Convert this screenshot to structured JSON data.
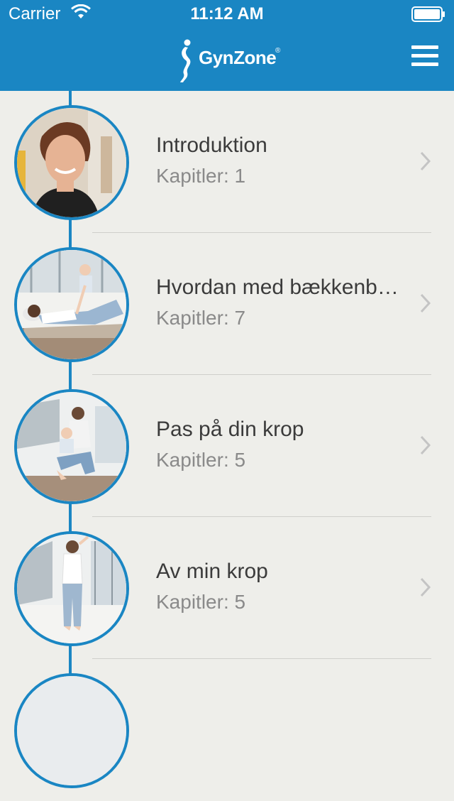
{
  "status_bar": {
    "carrier": "Carrier",
    "time": "11:12 AM"
  },
  "nav": {
    "logo_text": "GynZone",
    "logo_mark": "®",
    "menu_icon": "hamburger-menu-icon"
  },
  "colors": {
    "brand_blue": "#1a86c3",
    "background": "#eeeeea"
  },
  "courses": [
    {
      "title": "Introduktion",
      "subtitle": "Kapitler: 1"
    },
    {
      "title": "Hvordan med bækkenb…",
      "subtitle": "Kapitler: 7"
    },
    {
      "title": "Pas på din krop",
      "subtitle": "Kapitler: 5"
    },
    {
      "title": "Av min krop",
      "subtitle": "Kapitler: 5"
    }
  ]
}
